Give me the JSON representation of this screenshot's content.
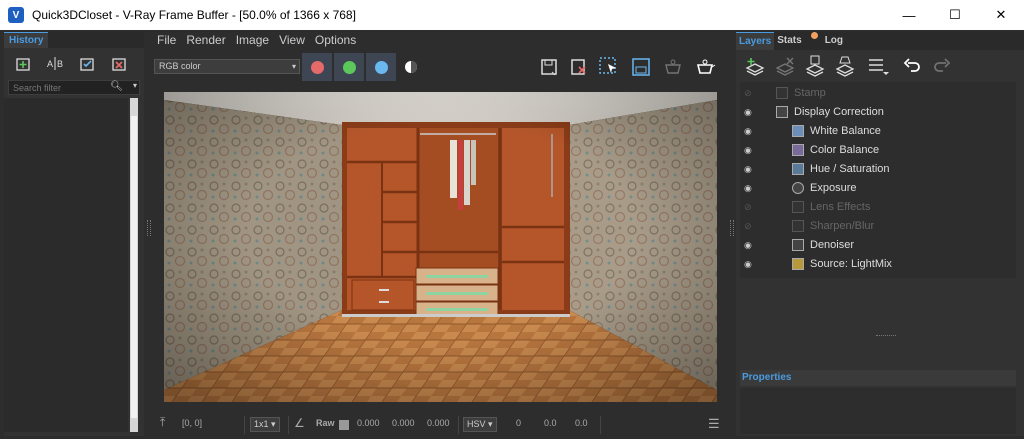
{
  "window": {
    "title": "Quick3DCloset - V-Ray Frame Buffer - [50.0% of 1366 x 768]",
    "app_icon": "vray-logo-icon",
    "controls": [
      "minimize-icon",
      "maximize-icon",
      "close-icon"
    ]
  },
  "history": {
    "tab_label": "History",
    "toolbar_icons": [
      "save-history-icon",
      "compare-ab-icon",
      "apply-history-icon",
      "remove-history-icon"
    ],
    "search": {
      "placeholder": "Search filter"
    }
  },
  "menu": {
    "items": [
      "File",
      "Render",
      "Image",
      "View",
      "Options"
    ]
  },
  "toolbar": {
    "channel": "RGB color",
    "channel_colors": {
      "red": "#e66a6a",
      "green": "#5cc85c",
      "blue": "#6ab8f0"
    },
    "right_icons": [
      "save-image-icon",
      "clear-image-icon",
      "region-render-icon",
      "toggle-panels-icon",
      "render-last-icon",
      "render-teapot-icon"
    ]
  },
  "statusbar": {
    "coords": "[0, 0]",
    "zoom": "1x1",
    "raw_label": "Raw",
    "raw_values": [
      "0.000",
      "0.000",
      "0.000"
    ],
    "color_mode": "HSV",
    "hsv_values": [
      "0",
      "0.0",
      "0.0"
    ]
  },
  "right_panel": {
    "tabs": [
      "Layers",
      "Stats",
      "Log"
    ],
    "toolbar_icons": [
      "add-layer-icon",
      "delete-layer-icon",
      "save-layers-icon",
      "load-layers-icon",
      "layer-list-icon",
      "undo-icon",
      "redo-icon"
    ],
    "layers": [
      {
        "name": "Stamp",
        "enabled": false
      },
      {
        "name": "Display Correction",
        "enabled": true
      },
      {
        "name": "White Balance",
        "enabled": true
      },
      {
        "name": "Color Balance",
        "enabled": true
      },
      {
        "name": "Hue / Saturation",
        "enabled": true
      },
      {
        "name": "Exposure",
        "enabled": true
      },
      {
        "name": "Lens Effects",
        "enabled": false
      },
      {
        "name": "Sharpen/Blur",
        "enabled": false
      },
      {
        "name": "Denoiser",
        "enabled": true
      },
      {
        "name": "Source: LightMix",
        "enabled": true
      }
    ],
    "properties_label": "Properties"
  }
}
